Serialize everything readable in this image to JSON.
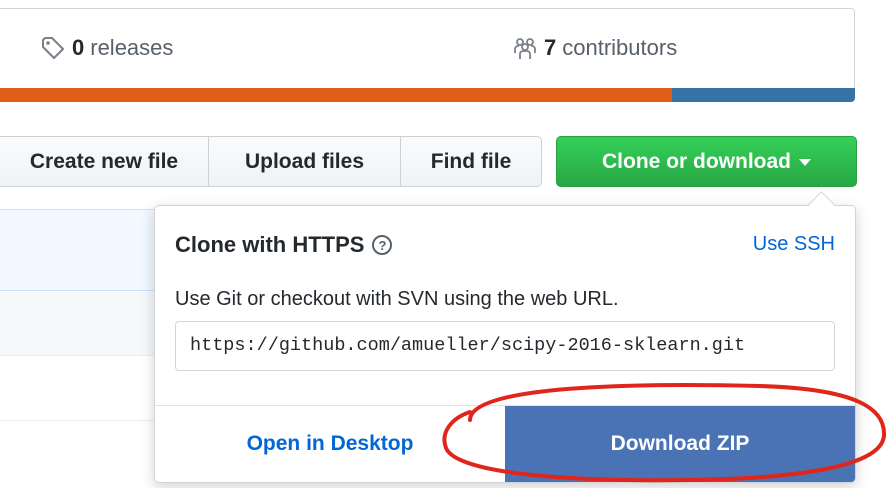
{
  "summary": {
    "releases": {
      "count": "0",
      "label": "releases",
      "icon": "tag-icon"
    },
    "contributors": {
      "count": "7",
      "label": "contributors",
      "icon": "organization-icon"
    }
  },
  "language_bar": {
    "segments": [
      {
        "color": "#e05d1a",
        "fraction": 0.786
      },
      {
        "color": "#3572a5",
        "fraction": 0.214
      }
    ]
  },
  "file_nav": {
    "create_new_file": "Create new file",
    "upload_files": "Upload files",
    "find_file": "Find file",
    "clone_or_download": "Clone or download"
  },
  "clone_popup": {
    "title": "Clone with HTTPS",
    "help_icon": "?",
    "use_ssh": "Use SSH",
    "description": "Use Git or checkout with SVN using the web URL.",
    "url": "https://github.com/amueller/scipy-2016-sklearn.git",
    "open_in_desktop": "Open in Desktop",
    "download_zip": "Download ZIP"
  },
  "colors": {
    "green_button": "#28a745",
    "link_blue": "#0366d6",
    "download_blue": "#4a73b6",
    "annotation_red": "#e0261b"
  }
}
